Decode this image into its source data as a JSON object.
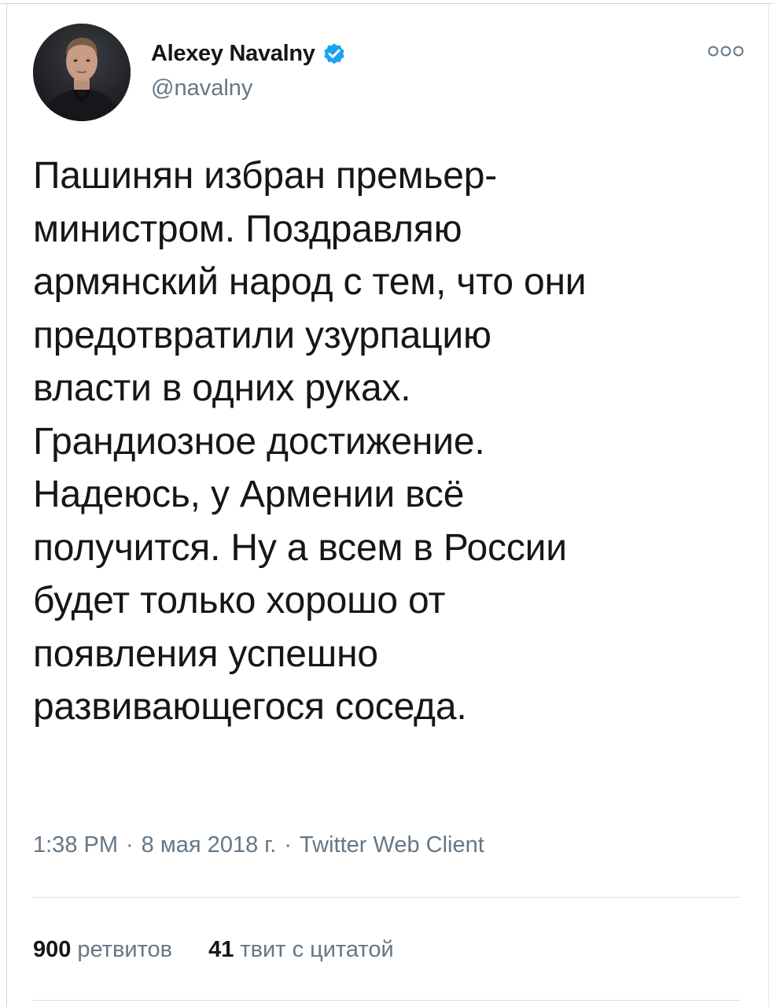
{
  "tweet": {
    "author": {
      "display_name": "Alexey Navalny",
      "handle": "@navalny",
      "verified": true,
      "avatar_icon": "profile-photo"
    },
    "more_icon": "more-options-icon",
    "text_lines": [
      "Пашинян избран премьер-",
      "министром. Поздравляю",
      "армянский народ с тем, что они",
      "предотвратили узурпацию",
      "власти в одних руках.",
      "Грандиозное достижение.",
      "Надеюсь, у Армении всё",
      "получится. Ну а всем в России",
      "будет только хорошо от",
      "появления успешно",
      "развивающегося соседа."
    ],
    "meta": {
      "time": "1:38 PM",
      "separator": "·",
      "date": "8 мая 2018 г.",
      "source": "Twitter Web Client"
    },
    "stats": {
      "retweets_count": "900",
      "retweets_label": "ретвитов",
      "quotes_count": "41",
      "quotes_label": "твит с цитатой"
    }
  },
  "colors": {
    "text_primary": "#14171a",
    "text_secondary": "#657786",
    "verified_blue": "#1da1f2",
    "divider": "#d9dfe3"
  }
}
